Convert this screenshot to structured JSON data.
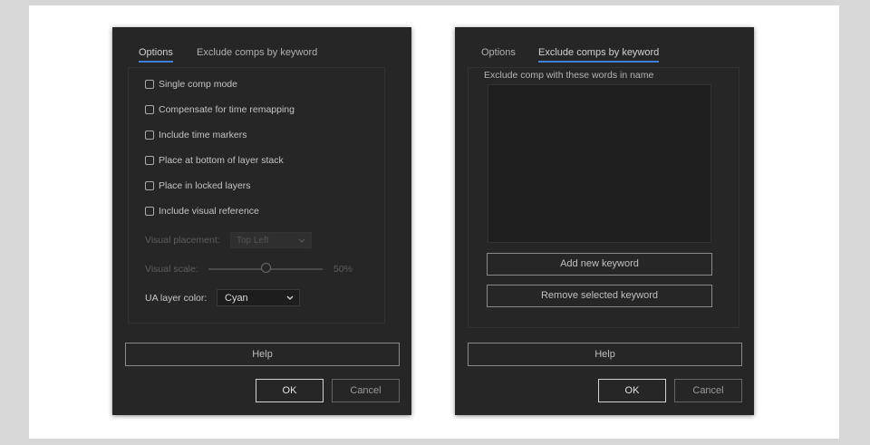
{
  "left_dialog": {
    "tabs": [
      {
        "label": "Options",
        "active": true
      },
      {
        "label": "Exclude comps by keyword",
        "active": false
      }
    ],
    "checkboxes": [
      {
        "label": "Single comp mode",
        "checked": false
      },
      {
        "label": "Compensate for time remapping",
        "checked": false
      },
      {
        "label": "Include time markers",
        "checked": false
      },
      {
        "label": "Place at bottom of layer stack",
        "checked": false
      },
      {
        "label": "Place in locked layers",
        "checked": false
      },
      {
        "label": "Include visual reference",
        "checked": false
      }
    ],
    "visual_placement_label": "Visual placement:",
    "visual_placement_value": "Top Left",
    "visual_scale_label": "Visual scale:",
    "visual_scale_value": "50%",
    "visual_scale_fraction": 0.5,
    "ua_color_label": "UA layer color:",
    "ua_color_value": "Cyan",
    "help_label": "Help",
    "ok_label": "OK",
    "cancel_label": "Cancel"
  },
  "right_dialog": {
    "tabs": [
      {
        "label": "Options",
        "active": false
      },
      {
        "label": "Exclude comps by keyword",
        "active": true
      }
    ],
    "group_label": "Exclude comp with these words in name",
    "add_keyword_label": "Add new keyword",
    "remove_keyword_label": "Remove selected keyword",
    "help_label": "Help",
    "ok_label": "OK",
    "cancel_label": "Cancel"
  },
  "colors": {
    "dialog_bg": "#262626",
    "accent_underline": "#3b82d6",
    "page_bg": "#d7d7d7"
  }
}
